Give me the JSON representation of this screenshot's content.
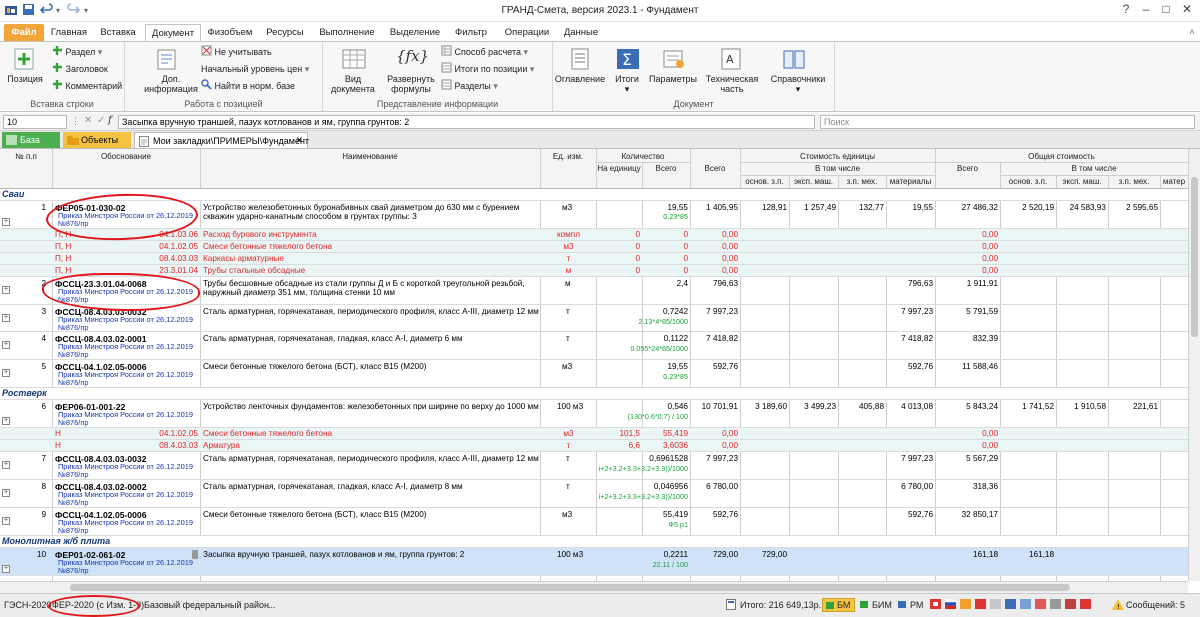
{
  "window": {
    "title": "ГРАНД-Смета, версия 2023.1 - Фундамент"
  },
  "tabs": [
    "Файл",
    "Главная",
    "Вставка",
    "Документ",
    "Физобъем",
    "Ресурсы",
    "Выполнение",
    "Выделение",
    "Фильтр",
    "Операции",
    "Данные"
  ],
  "ribbon": {
    "insert_row": {
      "label": "Вставка строки",
      "position": "Позиция",
      "razdel": "Раздел",
      "zagolovok": "Заголовок",
      "kommentariy": "Комментарий"
    },
    "work_pos": {
      "label": "Работа с позицией",
      "dop_info": "Доп. информация",
      "ne_uchit": "Не учитывать",
      "nach_uroven": "Начальный уровень цен",
      "nayti": "Найти в норм. базе"
    },
    "pred_info": {
      "label": "Представление информации",
      "vid": "Вид документа",
      "razvernut": "Развернуть формулы",
      "sposob": "Способ расчета",
      "itogi_po": "Итоги по позиции",
      "razdely": "Разделы"
    },
    "document": {
      "label": "Документ",
      "oglavlenie": "Оглавление",
      "itogi": "Итоги",
      "parametry": "Параметры",
      "tech": "Техническая часть",
      "spravochniki": "Справочники"
    }
  },
  "formula_bar": {
    "cell": "10",
    "value": "Засыпка вручную траншей, пазух котлованов и ям, группа грунтов: 2",
    "search_placeholder": "Поиск"
  },
  "doc_tabs": {
    "baza": "База",
    "objekty": "Объекты",
    "path": "Мои закладки\\ПРИМЕРЫ\\Фундамент"
  },
  "columns": {
    "num": "№ п.п",
    "obosn": "Обоснование",
    "naim": "Наименование",
    "ed": "Ед. изм.",
    "kol": "Количество",
    "na_ed": "На единицу",
    "vsego": "Всего",
    "stoim_ed": "Стоимость единицы",
    "v_tom": "В том числе",
    "osn_zp": "основ. з.п.",
    "eksp": "эксп. маш.",
    "zp_meh": "з.п. мех.",
    "mat": "материалы",
    "obsh": "Общая стоимость",
    "osn_zp2": "основ. з.п.",
    "eksp2": "эксп. маш.",
    "zp_meh2": "з.п. мех.",
    "mat2": "матер"
  },
  "order_text": "Приказ Минстроя России от 26.12.2019 №876/пр",
  "sections": {
    "s1": "Сваи",
    "s2": "Ростверк",
    "s3": "Монолитная ж/б плита"
  },
  "rows": [
    {
      "n": "1",
      "code": "ФЕР05-01-030-02",
      "name": "Устройство железобетонных буронабивных свай диаметром до 630 мм с бурением скважин ударно-канатным способом в грунтах группы: 3",
      "ed": "м3",
      "qty": "19,55",
      "f": "0.23*85",
      "vsego": "1 405,95",
      "oz": "128,91",
      "em": "1 257,49",
      "zm": "132,77",
      "mat": "19,55",
      "tot": "27 486,32",
      "toz": "2 520,19",
      "tem": "24 583,93",
      "tzm": "2 595,65"
    },
    {
      "n": "2",
      "code": "ФССЦ-23.3.01.04-0068",
      "name": "Трубы бесшовные обсадные из стали группы Д и Б с короткой треугольной резьбой, наружный диаметр 351 мм, толщина стенки 10 мм",
      "ed": "м",
      "qty": "2,4",
      "vsego": "796,63",
      "mat": "796,63",
      "tot": "1 911,91"
    },
    {
      "n": "3",
      "code": "ФССЦ-08.4.03.03-0032",
      "name": "Сталь арматурная, горячекатаная, периодического профиля, класс А-III, диаметр 12 мм",
      "ed": "т",
      "qty": "0,7242",
      "f": "2.13*4*85/1000",
      "vsego": "7 997,23",
      "mat": "7 997,23",
      "tot": "5 791,59"
    },
    {
      "n": "4",
      "code": "ФССЦ-08.4.03.02-0001",
      "name": "Сталь арматурная, горячекатаная, гладкая, класс А-I, диаметр 6 мм",
      "ed": "т",
      "qty": "0,1122",
      "f": "0.055*24*85/1000",
      "vsego": "7 418,82",
      "mat": "7 418,82",
      "tot": "832,39"
    },
    {
      "n": "5",
      "code": "ФССЦ-04.1.02.05-0006",
      "name": "Смеси бетонные тяжелого бетона (БСТ), класс В15 (М200)",
      "ed": "м3",
      "qty": "19,55",
      "f": "0.23*85",
      "vsego": "592,76",
      "mat": "592,76",
      "tot": "11 588,46"
    },
    {
      "n": "6",
      "code": "ФЕР06-01-001-22",
      "name": "Устройство ленточных фундаментов: железобетонных при ширине по верху до 1000 мм",
      "ed": "100 м3",
      "qty": "0,546",
      "f": "(130*0.6*0.7) / 100",
      "vsego": "10 701,91",
      "oz": "3 189,60",
      "em": "3 499,23",
      "zm": "405,88",
      "mat": "4 013,08",
      "tot": "5 843,24",
      "toz": "1 741,52",
      "tem": "1 910,58",
      "tzm": "221,61"
    },
    {
      "n": "7",
      "code": "ФССЦ-08.4.03.03-0032",
      "name": "Сталь арматурная, горячекатаная, периодического профиля, класс А-III, диаметр 12 мм",
      "ed": "т",
      "qty": "0,6961528",
      "f": "i+2+3.2+3.3+3.2+3.3))/1000",
      "vsego": "7 997,23",
      "mat": "7 997,23",
      "tot": "5 567,29"
    },
    {
      "n": "8",
      "code": "ФССЦ-08.4.03.02-0002",
      "name": "Сталь арматурная, горячекатаная, гладкая, класс А-I, диаметр 8 мм",
      "ed": "т",
      "qty": "0,046956",
      "f": "i+2+3.2+3.3+3.2+3.3))/1000",
      "vsego": "6 780,00",
      "mat": "6 780,00",
      "tot": "318,36"
    },
    {
      "n": "9",
      "code": "ФССЦ-04.1.02.05-0006",
      "name": "Смеси бетонные тяжелого бетона (БСТ), класс В15 (М200)",
      "ed": "м3",
      "qty": "55,419",
      "f": "Ф5.р1",
      "vsego": "592,76",
      "mat": "592,76",
      "tot": "32 850,17"
    },
    {
      "n": "10",
      "code": "ФЕР01-02-061-02",
      "name": "Засыпка вручную траншей, пазух котлованов и ям, группа грунтов: 2",
      "ed": "100 м3",
      "qty": "0,2211",
      "f": "22.11 / 100",
      "vsego": "729,00",
      "oz": "729,00",
      "tot": "161,18",
      "toz": "161,18"
    }
  ],
  "res1": [
    {
      "t": "П, Н",
      "code": "04.1.03.06",
      "name": "Расход бурового инструмента",
      "ed": "компл",
      "a": "0",
      "b": "0",
      "c": "0,00",
      "d": "0,00"
    },
    {
      "t": "П, Н",
      "code": "04.1.02.05",
      "name": "Смеси бетонные тяжелого бетона",
      "ed": "м3",
      "a": "0",
      "b": "0",
      "c": "0,00",
      "d": "0,00"
    },
    {
      "t": "П, Н",
      "code": "08.4.03.03",
      "name": "Каркасы арматурные",
      "ed": "т",
      "a": "0",
      "b": "0",
      "c": "0,00",
      "d": "0,00"
    },
    {
      "t": "П, Н",
      "code": "23.3.01.04",
      "name": "Трубы стальные обсадные",
      "ed": "м",
      "a": "0",
      "b": "0",
      "c": "0,00",
      "d": "0,00"
    }
  ],
  "res6": [
    {
      "t": "Н",
      "code": "04.1.02.05",
      "name": "Смеси бетонные тяжелого бетона",
      "ed": "м3",
      "a": "101,5",
      "b": "55,419",
      "c": "0,00",
      "d": "0,00"
    },
    {
      "t": "Н",
      "code": "08.4.03.03",
      "name": "Арматура",
      "ed": "т",
      "a": "6,6",
      "b": "3,6036",
      "c": "0,00",
      "d": "0,00"
    }
  ],
  "status": {
    "gesn": "ГЭСН-2020",
    "fer": "ФЕР-2020 (с Изм. 1-9)",
    "region": "Базовый федеральный район",
    "dots": "...",
    "itogo": "Итого: 216 649,13р.",
    "bm": "БМ",
    "bim": "БИМ",
    "rm": "РМ",
    "msgs": "Сообщений: 5"
  },
  "colors": {
    "accent": "#2b579a",
    "file_tab": "#f1a53b",
    "red": "#e0262a",
    "order_blue": "#1737b8",
    "formula_green": "#1aa33b",
    "section_blue": "#15377a"
  }
}
